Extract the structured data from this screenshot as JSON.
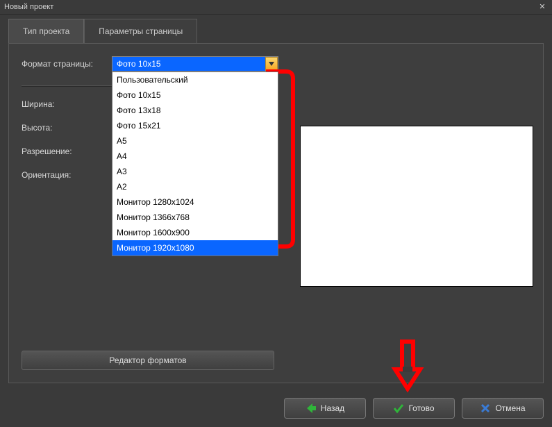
{
  "window": {
    "title": "Новый проект"
  },
  "tabs": {
    "project_type": "Тип проекта",
    "page_params": "Параметры страницы"
  },
  "form": {
    "label_format": "Формат страницы:",
    "label_width": "Ширина:",
    "label_height": "Высота:",
    "label_resolution": "Разрешение:",
    "label_orientation": "Ориентация:",
    "selected_format": "Фото 10х15",
    "options": [
      "Пользовательский",
      "Фото 10х15",
      "Фото 13х18",
      "Фото 15х21",
      "А5",
      "А4",
      "А3",
      "А2",
      "Монитор 1280х1024",
      "Монитор 1366х768",
      "Монитор 1600х900",
      "Монитор 1920х1080"
    ],
    "highlighted_option": "Монитор 1920х1080",
    "editor_button": "Редактор форматов"
  },
  "buttons": {
    "back": "Назад",
    "done": "Готово",
    "cancel": "Отмена"
  }
}
